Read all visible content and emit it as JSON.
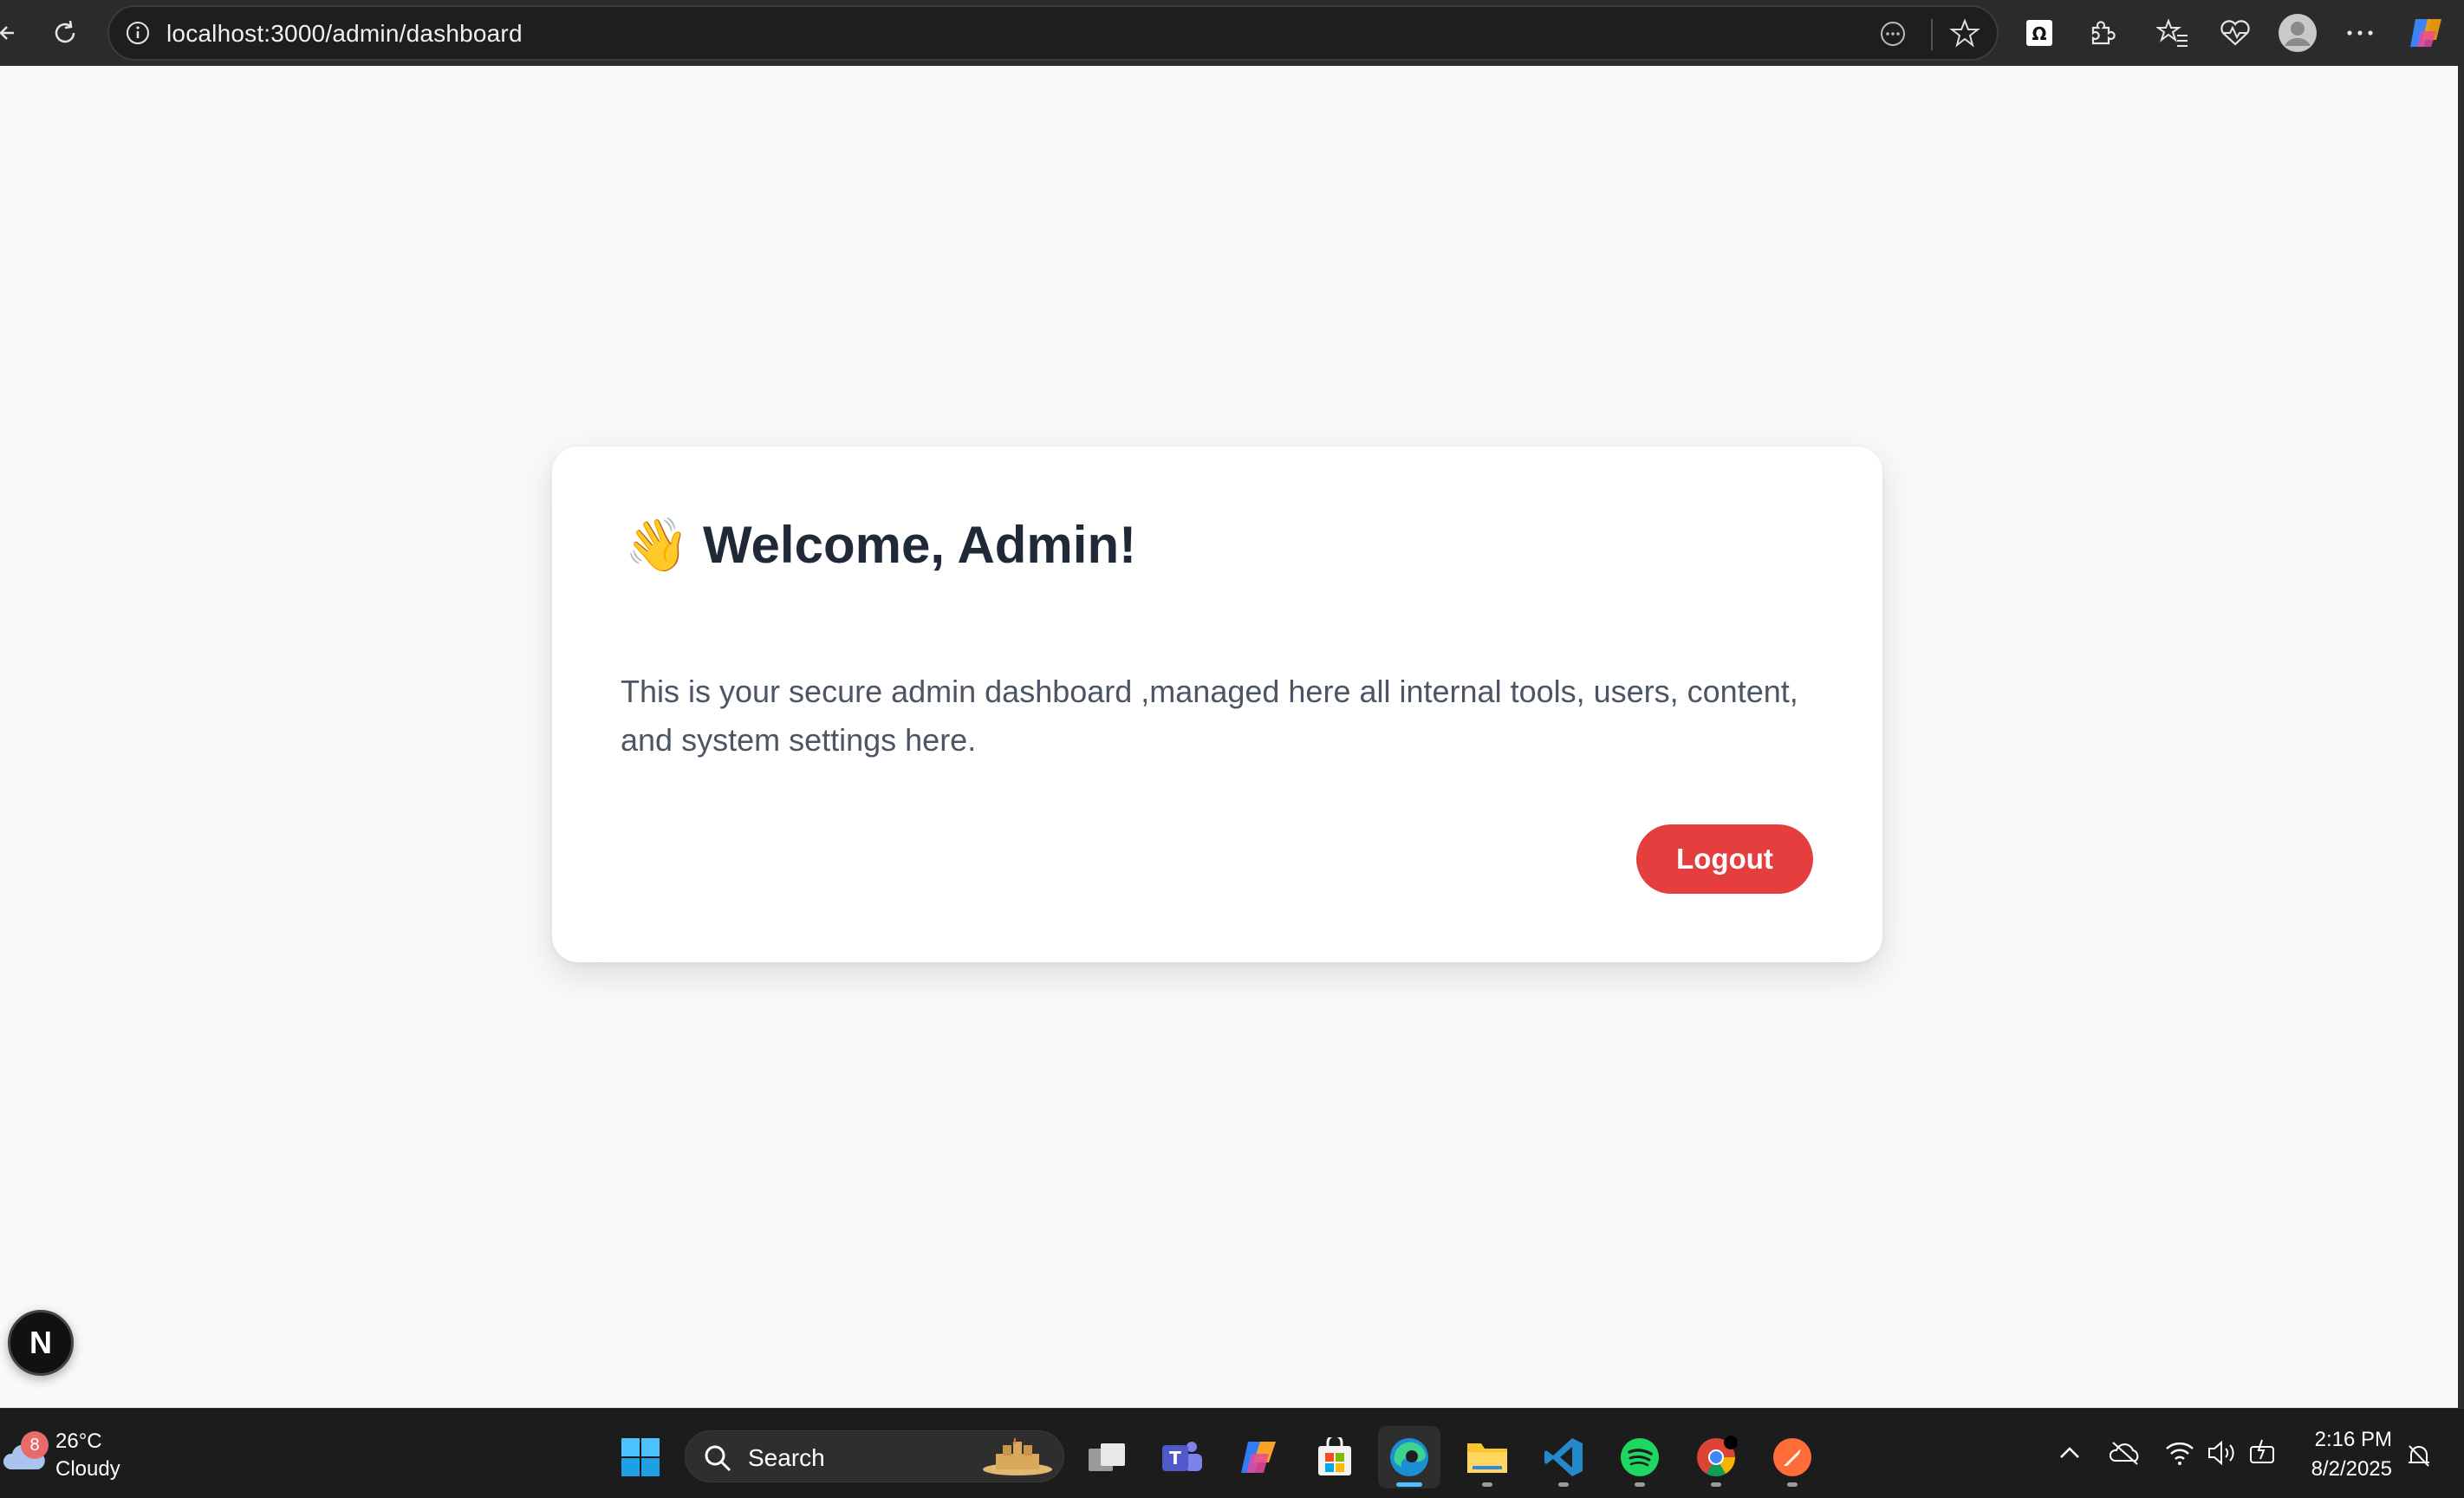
{
  "browser": {
    "url": "localhost:3000/admin/dashboard",
    "icons": [
      "back-icon",
      "refresh-icon",
      "site-info-icon",
      "reader-icon",
      "favorite-star-icon",
      "extension-omega-icon",
      "extensions-icon",
      "favorites-icon",
      "health-icon",
      "profile-icon",
      "more-icon",
      "copilot-icon"
    ]
  },
  "dashboard": {
    "wave_emoji": "👋",
    "title": "Welcome, Admin!",
    "description": "This is your secure admin dashboard ,managed here all internal tools, users, content, and system settings here.",
    "logout_label": "Logout",
    "accent_color": "#e53e3e"
  },
  "next_badge": {
    "letter": "N"
  },
  "taskbar": {
    "weather": {
      "badge": "8",
      "temp": "26°C",
      "condition": "Cloudy"
    },
    "search_label": "Search",
    "apps": [
      "start",
      "task-view",
      "teams",
      "copilot",
      "store",
      "edge",
      "file-explorer",
      "vscode",
      "spotify",
      "chrome",
      "postman"
    ],
    "clock": {
      "time": "2:16 PM",
      "date": "8/2/2025"
    }
  }
}
